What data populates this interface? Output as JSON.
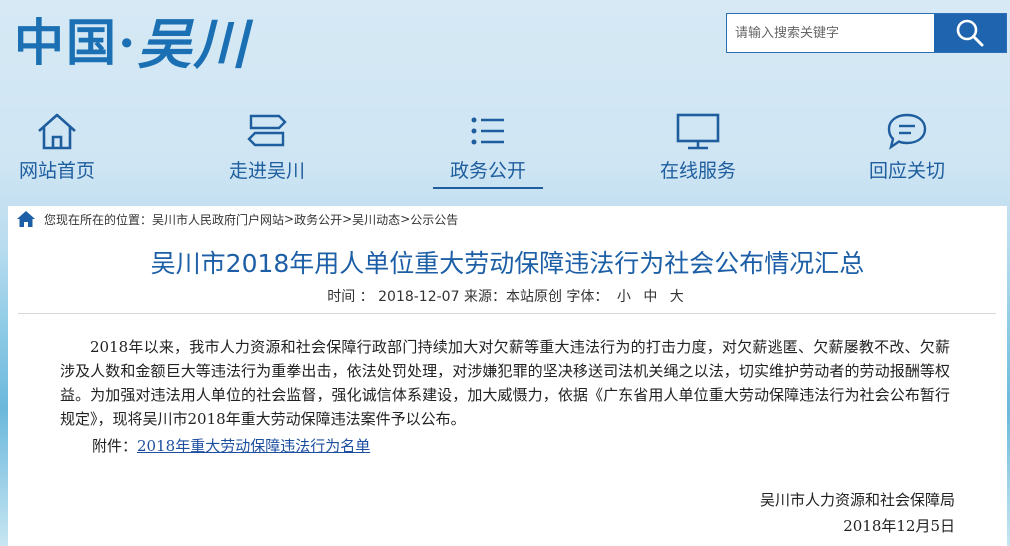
{
  "header": {
    "logo_part1": "中国·",
    "logo_part2": "吴川",
    "search_placeholder": "请输入搜索关键字"
  },
  "nav": {
    "items": [
      {
        "label": "网站首页",
        "icon": "home-icon"
      },
      {
        "label": "走进吴川",
        "icon": "signpost-icon"
      },
      {
        "label": "政务公开",
        "icon": "list-icon",
        "active": true
      },
      {
        "label": "在线服务",
        "icon": "monitor-icon"
      },
      {
        "label": "回应关切",
        "icon": "chat-icon"
      }
    ]
  },
  "breadcrumb": {
    "prefix": "您现在所在的位置：",
    "items": [
      "吴川市人民政府门户网站",
      "政务公开",
      "吴川动态",
      "公示公告"
    ],
    "sep": ">"
  },
  "article": {
    "title": "吴川市2018年用人单位重大劳动保障违法行为社会公布情况汇总",
    "meta_time_label": "时间 ：",
    "meta_time": "2018-12-07",
    "meta_source": "来源：本站原创",
    "meta_font_label": "字体：",
    "font_sizes": [
      "小",
      "中",
      "大"
    ],
    "paragraph": "2018年以来，我市人力资源和社会保障行政部门持续加大对欠薪等重大违法行为的打击力度，对欠薪逃匿、欠薪屡教不改、欠薪涉及人数和金额巨大等违法行为重拳出击，依法处罚处理，对涉嫌犯罪的坚决移送司法机关绳之以法，切实维护劳动者的劳动报酬等权益。为加强对违法用人单位的社会监督，强化诚信体系建设，加大威慑力，依据《广东省用人单位重大劳动保障违法行为社会公布暂行规定》，现将吴川市2018年重大劳动保障违法案件予以公布。",
    "attachment_label": "附件：",
    "attachment_link": "2018年重大劳动保障违法行为名单",
    "signature": "吴川市人力资源和社会保障局",
    "date": "2018年12月5日"
  },
  "colors": {
    "brand": "#1b6fb3",
    "nav_text": "#1e5d9e",
    "title": "#1d5fa6",
    "search_button": "#1f64ae"
  }
}
